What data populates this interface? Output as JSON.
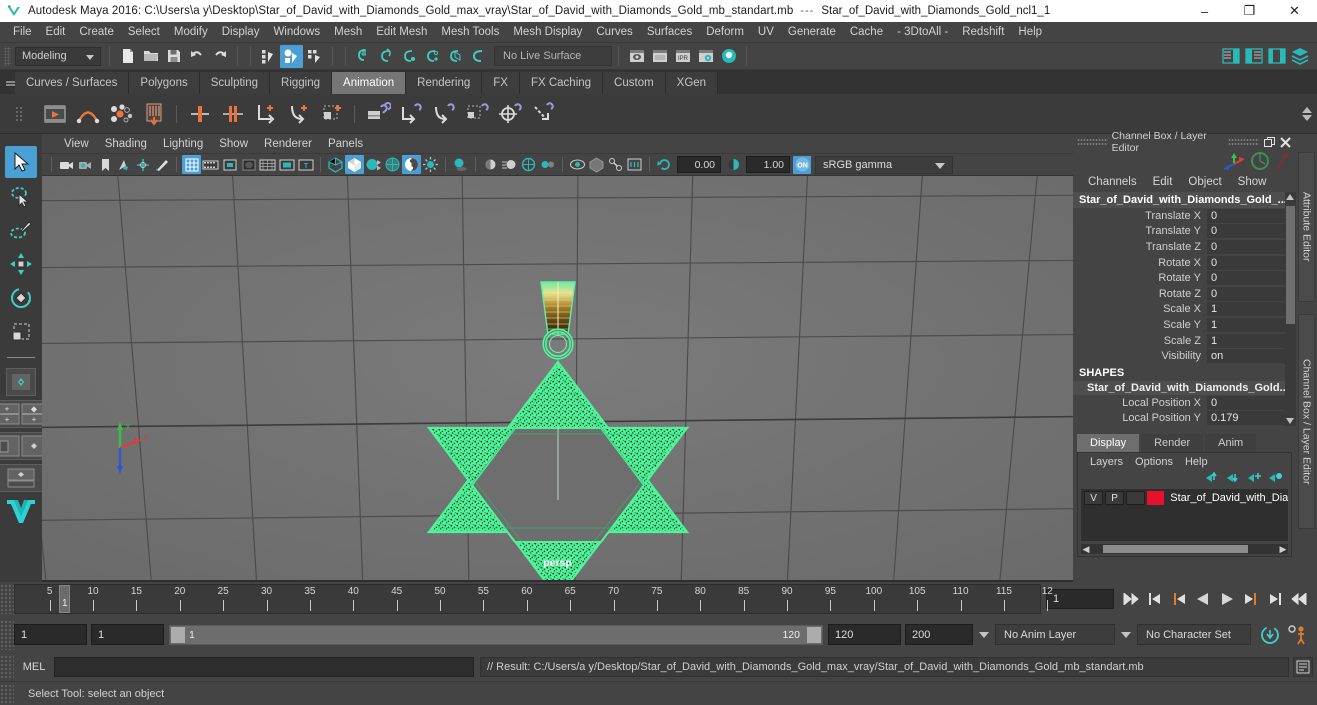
{
  "titlebar": {
    "app_title": "Autodesk Maya 2016: C:\\Users\\a y\\Desktop\\Star_of_David_with_Diamonds_Gold_max_vray\\Star_of_David_with_Diamonds_Gold_mb_standart.mb",
    "separator": "---",
    "sub_title": "Star_of_David_with_Diamonds_Gold_ncl1_1",
    "minimize": "–",
    "maximize": "❐",
    "close": "✕"
  },
  "menubar": {
    "items": [
      "File",
      "Edit",
      "Create",
      "Select",
      "Modify",
      "Display",
      "Windows",
      "Mesh",
      "Edit Mesh",
      "Mesh Tools",
      "Mesh Display",
      "Curves",
      "Surfaces",
      "Deform",
      "UV",
      "Generate",
      "Cache",
      "- 3DtoAll -",
      "Redshift",
      "Help"
    ]
  },
  "statusline": {
    "menuset": "Modeling",
    "live_surface": "No Live Surface"
  },
  "shelf": {
    "tabs": [
      {
        "label": "Curves / Surfaces",
        "active": false
      },
      {
        "label": "Polygons",
        "active": false
      },
      {
        "label": "Sculpting",
        "active": false
      },
      {
        "label": "Rigging",
        "active": false
      },
      {
        "label": "Animation",
        "active": true
      },
      {
        "label": "Rendering",
        "active": false
      },
      {
        "label": "FX",
        "active": false
      },
      {
        "label": "FX Caching",
        "active": false
      },
      {
        "label": "Custom",
        "active": false
      },
      {
        "label": "XGen",
        "active": false
      }
    ]
  },
  "viewport_panel": {
    "menus": [
      "View",
      "Shading",
      "Lighting",
      "Show",
      "Renderer",
      "Panels"
    ],
    "exposure_value": "0.00",
    "gamma_value": "1.00",
    "color_management": "sRGB gamma",
    "camera_label": "persp"
  },
  "channel_box": {
    "panel_title": "Channel Box / Layer Editor",
    "menus": [
      "Channels",
      "Edit",
      "Object",
      "Show"
    ],
    "object_name": "Star_of_David_with_Diamonds_Gold_...",
    "attributes": [
      {
        "label": "Translate X",
        "value": "0"
      },
      {
        "label": "Translate Y",
        "value": "0"
      },
      {
        "label": "Translate Z",
        "value": "0"
      },
      {
        "label": "Rotate X",
        "value": "0"
      },
      {
        "label": "Rotate Y",
        "value": "0"
      },
      {
        "label": "Rotate Z",
        "value": "0"
      },
      {
        "label": "Scale X",
        "value": "1"
      },
      {
        "label": "Scale Y",
        "value": "1"
      },
      {
        "label": "Scale Z",
        "value": "1"
      },
      {
        "label": "Visibility",
        "value": "on"
      }
    ],
    "shapes_header": "SHAPES",
    "shape_name": "Star_of_David_with_Diamonds_Gold...",
    "shape_attributes": [
      {
        "label": "Local Position X",
        "value": "0"
      },
      {
        "label": "Local Position Y",
        "value": "0.179"
      }
    ]
  },
  "layer_editor": {
    "tabs": [
      {
        "label": "Display",
        "active": true
      },
      {
        "label": "Render",
        "active": false
      },
      {
        "label": "Anim",
        "active": false
      }
    ],
    "menus": [
      "Layers",
      "Options",
      "Help"
    ],
    "layers": [
      {
        "visibility": "V",
        "playback": "P",
        "state": "",
        "color": "#e8112d",
        "name": "Star_of_David_with_Dian"
      }
    ]
  },
  "side_tabs": [
    {
      "label": "Attribute Editor"
    },
    {
      "label": "Channel Box / Layer Editor"
    }
  ],
  "timeline": {
    "ticks": [
      5,
      10,
      15,
      20,
      25,
      30,
      35,
      40,
      45,
      50,
      55,
      60,
      65,
      70,
      75,
      80,
      85,
      90,
      95,
      100,
      105,
      110,
      115
    ],
    "last_partial_label": "12",
    "current_frame": "1",
    "current_frame_field": "1",
    "playback_buttons": [
      "go-to-start",
      "step-back-keyframe",
      "step-back-frame",
      "play-backwards",
      "play-forwards",
      "step-forward-frame",
      "step-forward-keyframe",
      "go-to-end"
    ]
  },
  "range": {
    "anim_start": "1",
    "range_start": "1",
    "bar_start_label": "1",
    "bar_end_label": "120",
    "range_end": "120",
    "anim_end": "200",
    "anim_layer": "No Anim Layer",
    "character_set": "No Character Set"
  },
  "command_line": {
    "language": "MEL",
    "input_value": "",
    "output": "// Result: C:/Users/a y/Desktop/Star_of_David_with_Diamonds_Gold_max_vray/Star_of_David_with_Diamonds_Gold_mb_standart.mb"
  },
  "help_line": {
    "text": "Select Tool: select an object"
  },
  "colors": {
    "accent_blue": "#4a9fd4",
    "wireframe_green": "#5ef5a0",
    "layer_red": "#e8112d",
    "panel_bg": "#444444",
    "viewport_bg": "#727272"
  }
}
